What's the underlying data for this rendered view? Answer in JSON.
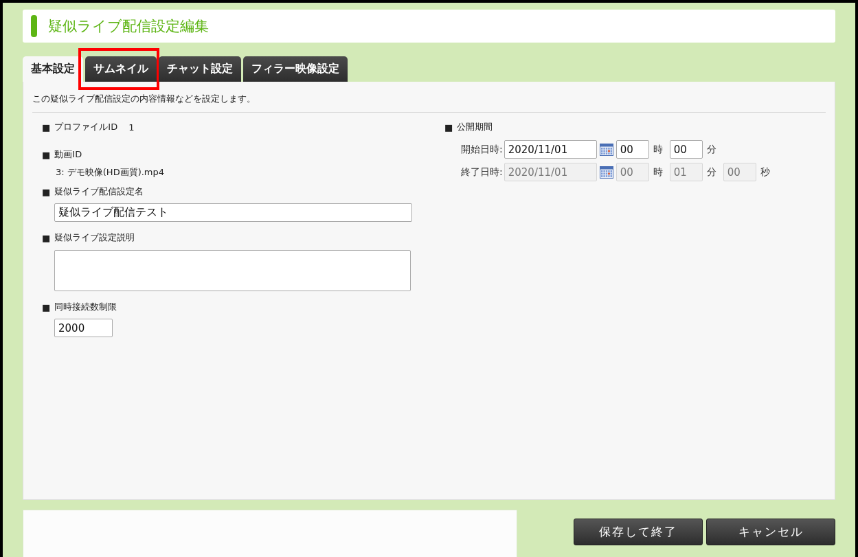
{
  "page": {
    "title": "疑似ライブ配信設定編集"
  },
  "tabs": [
    {
      "label": "基本設定",
      "selected": true,
      "highlighted": false
    },
    {
      "label": "サムネイル",
      "selected": false,
      "highlighted": true
    },
    {
      "label": "チャット設定",
      "selected": false,
      "highlighted": false
    },
    {
      "label": "フィラー映像設定",
      "selected": false,
      "highlighted": false
    }
  ],
  "panel": {
    "description": "この疑似ライブ配信設定の内容情報などを設定します。",
    "left": [
      {
        "kind": "inline",
        "marker": "■",
        "label": "プロファイルID",
        "value": "1"
      },
      {
        "kind": "stacked",
        "marker": "■",
        "label": "動画ID",
        "value": "3: デモ映像(HD画質).mp4"
      },
      {
        "kind": "input",
        "marker": "■",
        "label": "疑似ライブ配信設定名",
        "value": "疑似ライブ配信テスト"
      },
      {
        "kind": "textarea",
        "marker": "■",
        "label": "疑似ライブ設定説明"
      },
      {
        "kind": "short-input",
        "marker": "■",
        "label": "同時接続数制限",
        "value": "2000"
      }
    ],
    "right": {
      "marker": "■",
      "label": "公開期間",
      "rows": [
        {
          "label": "開始日時:",
          "disabled": false,
          "date": "2020/11/01",
          "parts": [
            {
              "value": "00",
              "unit": "時"
            },
            {
              "value": "00",
              "unit": "分"
            }
          ]
        },
        {
          "label": "終了日時:",
          "disabled": true,
          "date": "2020/11/01",
          "parts": [
            {
              "value": "00",
              "unit": "時"
            },
            {
              "value": "01",
              "unit": "分"
            },
            {
              "value": "00",
              "unit": "秒"
            }
          ]
        }
      ]
    }
  },
  "buttons": [
    "保存して終了",
    "キャンセル"
  ]
}
